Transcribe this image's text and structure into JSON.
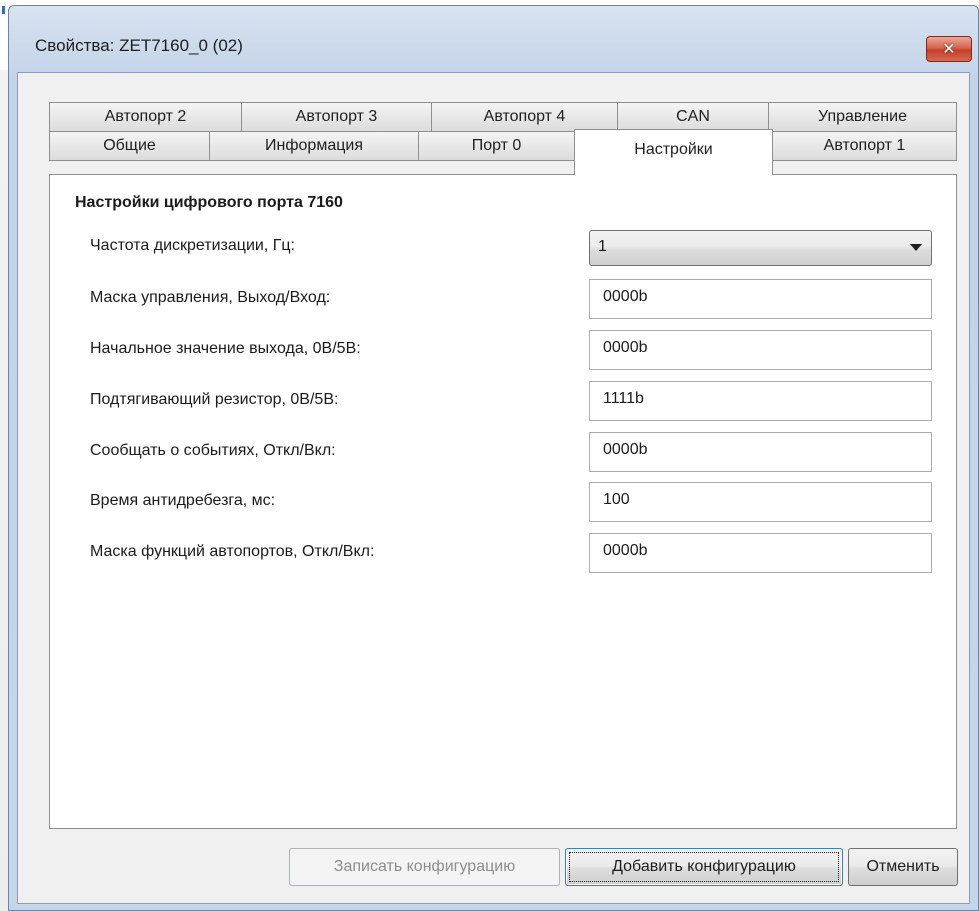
{
  "window": {
    "title": "Свойства: ZET7160_0 (02)",
    "close_icon": "close-x"
  },
  "tabs": {
    "row_back": [
      {
        "label": "Автопорт 2"
      },
      {
        "label": "Автопорт 3"
      },
      {
        "label": "Автопорт 4"
      },
      {
        "label": "CAN"
      },
      {
        "label": "Управление"
      }
    ],
    "row_front": [
      {
        "label": "Общие"
      },
      {
        "label": "Информация"
      },
      {
        "label": "Порт 0"
      },
      {
        "label": "Настройки",
        "active": true
      },
      {
        "label": "Автопорт 1"
      }
    ]
  },
  "settings": {
    "group_title": "Настройки цифрового порта 7160",
    "sample_rate": {
      "label": "Частота дискретизации, Гц:",
      "value": "1"
    },
    "fields": [
      {
        "label": "Маска управления, Выход/Вход:",
        "value": "0000b"
      },
      {
        "label": "Начальное значение выхода, 0В/5В:",
        "value": "0000b"
      },
      {
        "label": "Подтягивающий резистор, 0В/5В:",
        "value": "1111b"
      },
      {
        "label": "Сообщать о событиях, Откл/Вкл:",
        "value": "0000b"
      },
      {
        "label": "Время антидребезга, мс:",
        "value": "100"
      },
      {
        "label": "Маска функций автопортов, Откл/Вкл:",
        "value": "0000b"
      }
    ]
  },
  "buttons": {
    "write_config": "Записать конфигурацию",
    "add_config": "Добавить конфигурацию",
    "cancel": "Отменить"
  },
  "colors": {
    "titlebar": "#cfdced",
    "close_button": "#c4402a",
    "panel_bg": "#ffffff",
    "dialog_bg": "#f0f0f0"
  }
}
